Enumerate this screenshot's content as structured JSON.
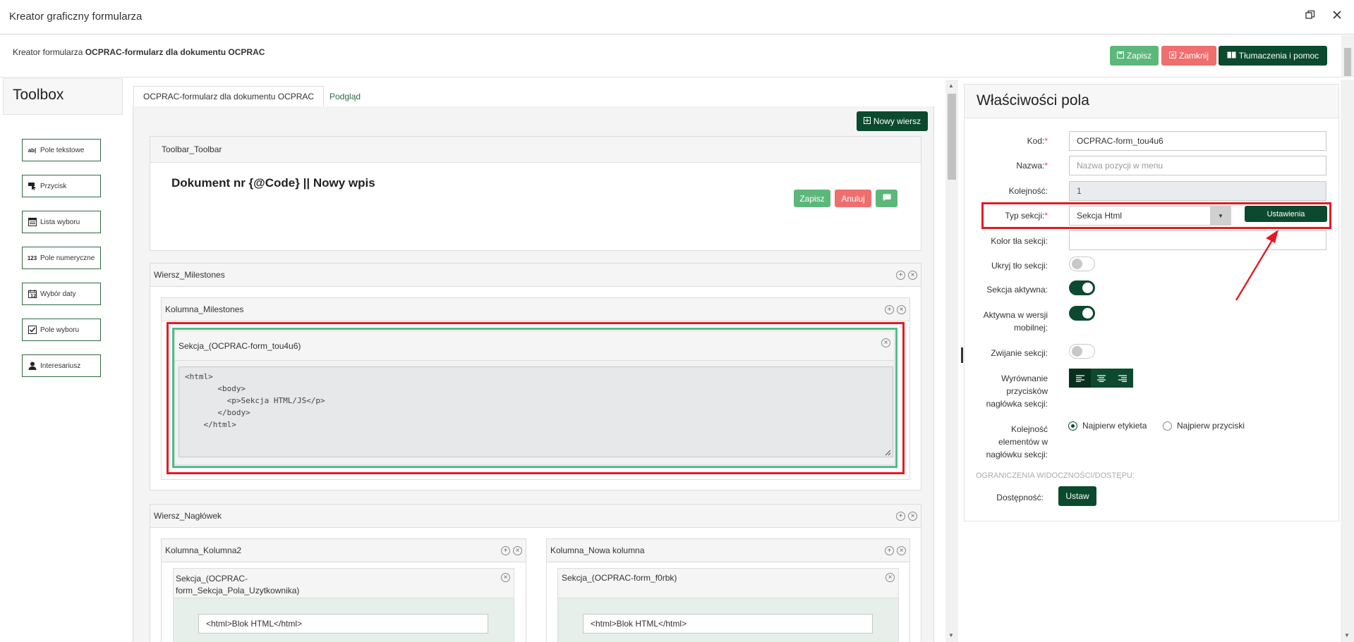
{
  "window": {
    "title": "Kreator graficzny formularza",
    "restore_icon": "restore-window-icon",
    "close_icon": "close-icon"
  },
  "header": {
    "prefix": "Kreator formularza",
    "form_name": "OCPRAC-formularz dla dokumentu OCPRAC",
    "save_label": "Zapisz",
    "close_label": "Zamknij",
    "help_label": "Tłumaczenia i pomoc"
  },
  "toolbox": {
    "title": "Toolbox",
    "items": [
      {
        "label": "Pole tekstowe",
        "icon": "text-field-icon"
      },
      {
        "label": "Przycisk",
        "icon": "cursor-click-icon"
      },
      {
        "label": "Lista wyboru",
        "icon": "list-icon"
      },
      {
        "label": "Pole numeryczne",
        "icon": "123-icon"
      },
      {
        "label": "Wybór daty",
        "icon": "calendar-icon"
      },
      {
        "label": "Pole wyboru",
        "icon": "checkbox-icon"
      },
      {
        "label": "Interesariusz",
        "icon": "person-icon"
      }
    ]
  },
  "tabs": [
    {
      "label": "OCPRAC-formularz dla dokumentu OCPRAC",
      "active": true
    },
    {
      "label": "Podgląd",
      "active": false
    }
  ],
  "canvas": {
    "new_row_label": "Nowy wiersz",
    "toolbar_panel": {
      "title": "Toolbar_Toolbar",
      "heading": "Dokument nr {@Code} || Nowy wpis",
      "save_label": "Zapisz",
      "cancel_label": "Anuluj",
      "comment_icon": "comment-icon"
    },
    "row_milestones": {
      "title": "Wiersz_Milestones",
      "column": {
        "title": "Kolumna_Milestones",
        "section": {
          "title": "Sekcja_(OCPRAC-form_tou4u6)",
          "code": "<html>\n       <body>\n         <p>Sekcja HTML/JS</p>\n       </body>\n    </html>"
        }
      }
    },
    "row_header": {
      "title": "Wiersz_Nagłówek",
      "col1": {
        "title": "Kolumna_Kolumna2",
        "section_title_line1": "Sekcja_(OCPRAC-",
        "section_title_line2": "form_Sekcja_Pola_Uzytkownika)",
        "html_value": "<html>Blok HTML</html>"
      },
      "col2": {
        "title": "Kolumna_Nowa kolumna",
        "section_title": "Sekcja_(OCPRAC-form_f0rbk)",
        "html_value": "<html>Blok HTML</html>"
      }
    }
  },
  "properties": {
    "title": "Właściwości pola",
    "code_label": "Kod:",
    "code_value": "OCPRAC-form_tou4u6",
    "name_label": "Nazwa:",
    "name_placeholder": "Nazwa pozycji w menu",
    "order_label": "Kolejność:",
    "order_value": "1",
    "section_type_label": "Typ sekcji:",
    "section_type_value": "Sekcja Html",
    "settings_label": "Ustawienia",
    "bg_color_label": "Kolor tła sekcji:",
    "hide_bg_label": "Ukryj tło sekcji:",
    "hide_bg": false,
    "active_label": "Sekcja aktywna:",
    "active": true,
    "mobile_label_1": "Aktywna w wersji",
    "mobile_label_2": "mobilnej:",
    "mobile": true,
    "collapse_label": "Zwijanie sekcji:",
    "collapse": false,
    "align_label_1": "Wyrównanie",
    "align_label_2": "przycisków",
    "align_label_3": "nagłówka sekcji:",
    "order_elems_label_1": "Kolejność",
    "order_elems_label_2": "elementów w",
    "order_elems_label_3": "nagłówku sekcji:",
    "radio_label_first": "Najpierw etykieta",
    "radio_label_second": "Najpierw przyciski",
    "restrictions_heading": "OGRANICZENIA WIDOCZNOŚCI/DOSTĘPU:",
    "access_label": "Dostępność:",
    "set_label": "Ustaw"
  },
  "colors": {
    "accent_dark": "#0b4a2f",
    "accent_green": "#5cb87a",
    "danger": "#ef6e6e",
    "highlight_red": "#e31b23"
  }
}
